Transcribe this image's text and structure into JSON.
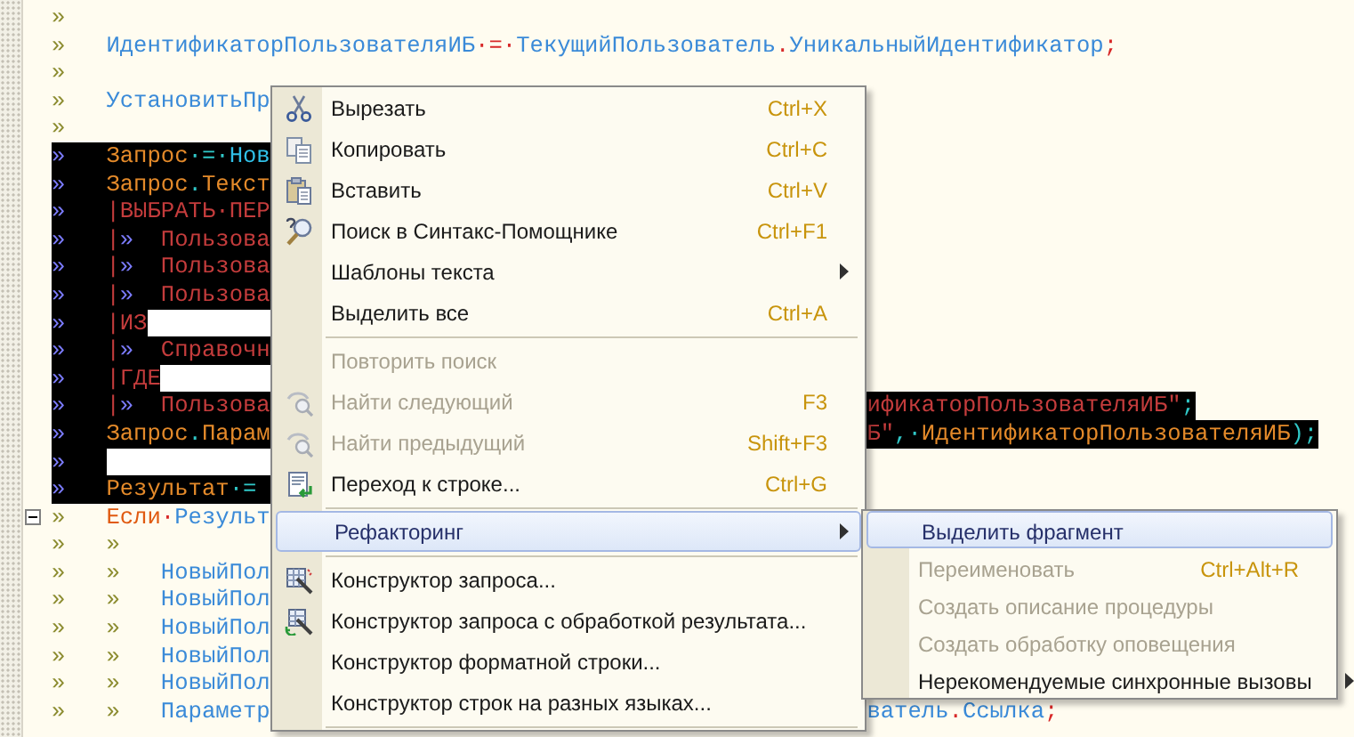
{
  "code_lines": [
    {
      "selected": false,
      "tokens": [
        {
          "kind": "tab",
          "text": "»"
        }
      ]
    },
    {
      "selected": false,
      "tokens": [
        {
          "kind": "tab",
          "text": "»"
        },
        {
          "kind": "ident",
          "text": "ИдентификаторПользователяИБ"
        },
        {
          "kind": "op",
          "text": "·=·"
        },
        {
          "kind": "ident",
          "text": "ТекущийПользователь"
        },
        {
          "kind": "op",
          "text": "."
        },
        {
          "kind": "ident",
          "text": "УникальныйИдентификатор"
        },
        {
          "kind": "op",
          "text": ";"
        }
      ]
    },
    {
      "selected": false,
      "tokens": [
        {
          "kind": "tab",
          "text": "»"
        }
      ]
    },
    {
      "selected": false,
      "tokens": [
        {
          "kind": "tab",
          "text": "»"
        },
        {
          "kind": "ident",
          "text": "УстановитьПр"
        }
      ]
    },
    {
      "selected": false,
      "tokens": [
        {
          "kind": "tab",
          "text": "»"
        }
      ]
    },
    {
      "selected": true,
      "tokens": [
        {
          "kind": "tab",
          "text": "»"
        },
        {
          "kind": "ident",
          "text": "Запрос"
        },
        {
          "kind": "op",
          "text": "·=·"
        },
        {
          "kind": "keyword",
          "text": "Нов"
        }
      ]
    },
    {
      "selected": true,
      "tokens": [
        {
          "kind": "tab",
          "text": "»"
        },
        {
          "kind": "ident",
          "text": "Запрос"
        },
        {
          "kind": "op",
          "text": "."
        },
        {
          "kind": "ident",
          "text": "Текст"
        }
      ]
    },
    {
      "selected": true,
      "tokens": [
        {
          "kind": "tab",
          "text": "»"
        },
        {
          "kind": "query",
          "text": "|ВЫБРАТЬ·ПЕР"
        }
      ]
    },
    {
      "selected": true,
      "tokens": [
        {
          "kind": "tab",
          "text": "»"
        },
        {
          "kind": "query",
          "text": "|"
        },
        {
          "kind": "tab",
          "text": "»"
        },
        {
          "kind": "query",
          "text": "Пользова"
        }
      ]
    },
    {
      "selected": true,
      "tokens": [
        {
          "kind": "tab",
          "text": "»"
        },
        {
          "kind": "query",
          "text": "|"
        },
        {
          "kind": "tab",
          "text": "»"
        },
        {
          "kind": "query",
          "text": "Пользова"
        }
      ]
    },
    {
      "selected": true,
      "tokens": [
        {
          "kind": "tab",
          "text": "»"
        },
        {
          "kind": "query",
          "text": "|"
        },
        {
          "kind": "tab",
          "text": "»"
        },
        {
          "kind": "query",
          "text": "Пользова"
        }
      ]
    },
    {
      "selected": true,
      "tokens": [
        {
          "kind": "tab",
          "text": "»"
        },
        {
          "kind": "query",
          "text": "|ИЗ"
        },
        {
          "kind": "blank"
        }
      ]
    },
    {
      "selected": true,
      "tokens": [
        {
          "kind": "tab",
          "text": "»"
        },
        {
          "kind": "query",
          "text": "|"
        },
        {
          "kind": "tab",
          "text": "»"
        },
        {
          "kind": "query",
          "text": "Справочн"
        }
      ]
    },
    {
      "selected": true,
      "tokens": [
        {
          "kind": "tab",
          "text": "»"
        },
        {
          "kind": "query",
          "text": "|ГДЕ"
        },
        {
          "kind": "blank"
        }
      ]
    },
    {
      "selected": true,
      "tokens": [
        {
          "kind": "tab",
          "text": "»"
        },
        {
          "kind": "query",
          "text": "|"
        },
        {
          "kind": "tab",
          "text": "»"
        },
        {
          "kind": "query",
          "text": "Пользова"
        }
      ],
      "tail": [
        {
          "kind": "query",
          "text": "ификаторПользователяИБ\""
        },
        {
          "kind": "op",
          "text": ";"
        }
      ]
    },
    {
      "selected": true,
      "tokens": [
        {
          "kind": "tab",
          "text": "»"
        },
        {
          "kind": "ident",
          "text": "Запрос"
        },
        {
          "kind": "op",
          "text": "."
        },
        {
          "kind": "ident",
          "text": "Парам"
        }
      ],
      "tail": [
        {
          "kind": "query",
          "text": "Б\""
        },
        {
          "kind": "op",
          "text": ",·"
        },
        {
          "kind": "ident",
          "text": "ИдентификаторПользователяИБ"
        },
        {
          "kind": "op",
          "text": ");"
        }
      ]
    },
    {
      "selected": true,
      "tokens": [
        {
          "kind": "tab",
          "text": "»"
        },
        {
          "kind": "blank"
        }
      ]
    },
    {
      "selected": true,
      "tokens": [
        {
          "kind": "tab",
          "text": "»"
        },
        {
          "kind": "ident",
          "text": "Результат"
        },
        {
          "kind": "op",
          "text": "·="
        }
      ]
    },
    {
      "selected": false,
      "fold_expanded": true,
      "tokens": [
        {
          "kind": "tab",
          "text": "»"
        },
        {
          "kind": "keyword",
          "text": "Если"
        },
        {
          "kind": "op",
          "text": "·"
        },
        {
          "kind": "ident",
          "text": "Результ"
        }
      ]
    },
    {
      "selected": false,
      "tokens": [
        {
          "kind": "tab",
          "text": "»"
        },
        {
          "kind": "tab",
          "text": "»"
        }
      ]
    },
    {
      "selected": false,
      "tokens": [
        {
          "kind": "tab",
          "text": "»"
        },
        {
          "kind": "tab",
          "text": "»"
        },
        {
          "kind": "ident",
          "text": "НовыйПол"
        }
      ]
    },
    {
      "selected": false,
      "tokens": [
        {
          "kind": "tab",
          "text": "»"
        },
        {
          "kind": "tab",
          "text": "»"
        },
        {
          "kind": "ident",
          "text": "НовыйПол"
        }
      ]
    },
    {
      "selected": false,
      "tokens": [
        {
          "kind": "tab",
          "text": "»"
        },
        {
          "kind": "tab",
          "text": "»"
        },
        {
          "kind": "ident",
          "text": "НовыйПол"
        }
      ]
    },
    {
      "selected": false,
      "tokens": [
        {
          "kind": "tab",
          "text": "»"
        },
        {
          "kind": "tab",
          "text": "»"
        },
        {
          "kind": "ident",
          "text": "НовыйПол"
        }
      ]
    },
    {
      "selected": false,
      "tokens": [
        {
          "kind": "tab",
          "text": "»"
        },
        {
          "kind": "tab",
          "text": "»"
        },
        {
          "kind": "ident",
          "text": "НовыйПол"
        }
      ]
    },
    {
      "selected": false,
      "tokens": [
        {
          "kind": "tab",
          "text": "»"
        },
        {
          "kind": "tab",
          "text": "»"
        },
        {
          "kind": "ident",
          "text": "Параметр"
        }
      ],
      "tail": [
        {
          "kind": "ident",
          "text": "ватель"
        },
        {
          "kind": "op",
          "text": "."
        },
        {
          "kind": "ident",
          "text": "Ссылка"
        },
        {
          "kind": "op",
          "text": ";"
        }
      ]
    }
  ],
  "context_menu": {
    "items": [
      {
        "kind": "item",
        "label": "Вырезать",
        "shortcut": "Ctrl+X",
        "disabled": false,
        "selected": false
      },
      {
        "kind": "item",
        "label": "Копировать",
        "shortcut": "Ctrl+C",
        "disabled": false,
        "selected": false
      },
      {
        "kind": "item",
        "label": "Вставить",
        "shortcut": "Ctrl+V",
        "disabled": false,
        "selected": false
      },
      {
        "kind": "item",
        "label": "Поиск в Синтакс-Помощнике",
        "shortcut": "Ctrl+F1",
        "disabled": false,
        "selected": false
      },
      {
        "kind": "submenu",
        "label": "Шаблоны текста",
        "disabled": false,
        "selected": false
      },
      {
        "kind": "item",
        "label": "Выделить все",
        "shortcut": "Ctrl+A",
        "disabled": false,
        "selected": false
      },
      {
        "kind": "separator"
      },
      {
        "kind": "item",
        "label": "Повторить поиск",
        "disabled": true,
        "selected": false
      },
      {
        "kind": "item",
        "label": "Найти следующий",
        "shortcut": "F3",
        "disabled": true,
        "selected": false
      },
      {
        "kind": "item",
        "label": "Найти предыдущий",
        "shortcut": "Shift+F3",
        "disabled": true,
        "selected": false
      },
      {
        "kind": "item",
        "label": "Переход к строке...",
        "shortcut": "Ctrl+G",
        "disabled": false,
        "selected": false
      },
      {
        "kind": "separator"
      },
      {
        "kind": "submenu",
        "label": "Рефакторинг",
        "disabled": false,
        "selected": true
      },
      {
        "kind": "separator"
      },
      {
        "kind": "item",
        "label": "Конструктор запроса...",
        "disabled": false,
        "selected": false
      },
      {
        "kind": "item",
        "label": "Конструктор запроса с обработкой результата...",
        "disabled": false,
        "selected": false
      },
      {
        "kind": "item",
        "label": "Конструктор форматной строки...",
        "disabled": false,
        "selected": false
      },
      {
        "kind": "item",
        "label": "Конструктор строк на разных языках...",
        "disabled": false,
        "selected": false
      },
      {
        "kind": "separator"
      }
    ]
  },
  "submenu": {
    "items": [
      {
        "kind": "item",
        "label": "Выделить фрагмент",
        "disabled": false,
        "selected": true
      },
      {
        "kind": "item",
        "label": "Переименовать",
        "shortcut": "Ctrl+Alt+R",
        "disabled": true,
        "selected": false
      },
      {
        "kind": "item",
        "label": "Создать описание процедуры",
        "disabled": true,
        "selected": false
      },
      {
        "kind": "item",
        "label": "Создать обработку оповещения",
        "disabled": true,
        "selected": false
      },
      {
        "kind": "submenu",
        "label": "Нерекомендуемые синхронные вызовы",
        "disabled": false,
        "selected": false
      }
    ]
  }
}
